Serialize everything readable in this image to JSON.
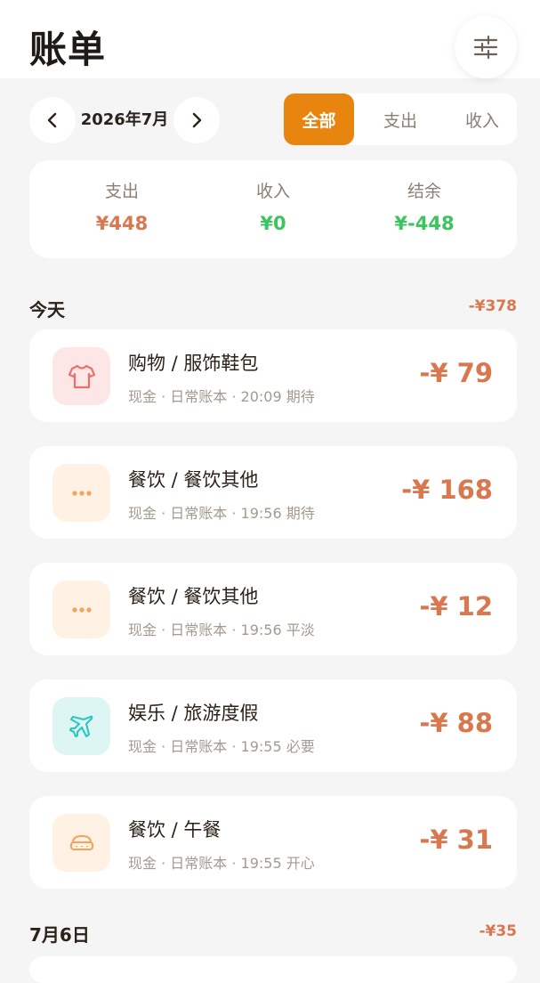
{
  "header": {
    "title": "账单"
  },
  "month": {
    "label": "2026年7月"
  },
  "tabs": [
    {
      "label": "全部",
      "active": true
    },
    {
      "label": "支出",
      "active": false
    },
    {
      "label": "收入",
      "active": false
    }
  ],
  "summary": {
    "expense_label": "支出",
    "expense_value": "¥448",
    "income_label": "收入",
    "income_value": "¥0",
    "balance_label": "结余",
    "balance_value": "¥-448"
  },
  "colors": {
    "accent": "#e8850f",
    "expense": "#d9774f",
    "income": "#3cc45e"
  },
  "days": [
    {
      "label": "今天",
      "total": "-¥378",
      "transactions": [
        {
          "title": "购物 / 服饰鞋包",
          "meta": "现金 · 日常账本 · 20:09 期待",
          "amount": "-¥ 79",
          "icon": "tshirt-icon"
        },
        {
          "title": "餐饮 / 餐饮其他",
          "meta": "现金 · 日常账本 · 19:56 期待",
          "amount": "-¥ 168",
          "icon": "more-dots-icon"
        },
        {
          "title": "餐饮 / 餐饮其他",
          "meta": "现金 · 日常账本 · 19:56 平淡",
          "amount": "-¥ 12",
          "icon": "more-dots-icon"
        },
        {
          "title": "娱乐 / 旅游度假",
          "meta": "现金 · 日常账本 · 19:55 必要",
          "amount": "-¥ 88",
          "icon": "airplane-icon"
        },
        {
          "title": "餐饮 / 午餐",
          "meta": "现金 · 日常账本 · 19:55 开心",
          "amount": "-¥ 31",
          "icon": "lunchbox-icon"
        }
      ]
    },
    {
      "label": "7月6日",
      "total": "-¥35",
      "transactions": []
    }
  ]
}
